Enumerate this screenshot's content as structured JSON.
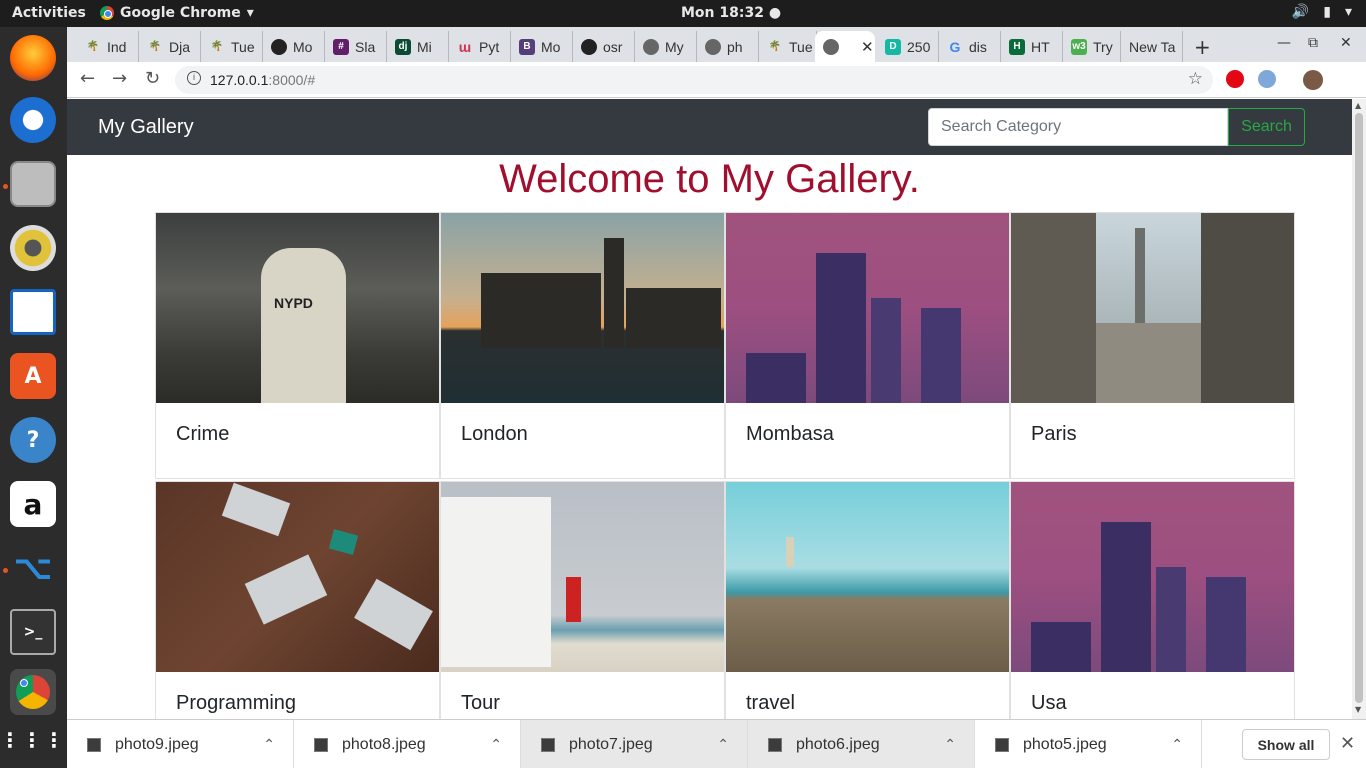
{
  "system": {
    "activities": "Activities",
    "app_name": "Google Chrome",
    "clock": "Mon 18:32"
  },
  "browser": {
    "tabs": [
      {
        "label": "Ind",
        "icon": "palm-icon"
      },
      {
        "label": "Dja",
        "icon": "palm-icon"
      },
      {
        "label": "Tue",
        "icon": "palm-icon"
      },
      {
        "label": "Mo",
        "icon": "github-icon"
      },
      {
        "label": "Sla",
        "icon": "slack-icon"
      },
      {
        "label": "Mi",
        "icon": "django-icon"
      },
      {
        "label": "Pyt",
        "icon": "python-icon"
      },
      {
        "label": "Mo",
        "icon": "bootstrap-icon"
      },
      {
        "label": "osr",
        "icon": "github-icon"
      },
      {
        "label": "My",
        "icon": "globe-icon"
      },
      {
        "label": "ph",
        "icon": "globe-icon"
      },
      {
        "label": "Tue",
        "icon": "palm-icon"
      },
      {
        "label": "",
        "icon": "globe-icon"
      },
      {
        "label": "250",
        "icon": "d-icon"
      },
      {
        "label": "dis",
        "icon": "google-icon"
      },
      {
        "label": "HT",
        "icon": "h-icon"
      },
      {
        "label": "Try",
        "icon": "w3-icon"
      },
      {
        "label": "New Ta",
        "icon": ""
      }
    ],
    "url_host": "127.0.0.1",
    "url_rest": ":8000/#"
  },
  "page": {
    "brand": "My Gallery",
    "search_placeholder": "Search Category",
    "search_button": "Search",
    "welcome": "Welcome to My Gallery.",
    "cards": [
      {
        "label": "Crime"
      },
      {
        "label": "London"
      },
      {
        "label": "Mombasa"
      },
      {
        "label": "Paris"
      },
      {
        "label": "Programming"
      },
      {
        "label": "Tour"
      },
      {
        "label": "travel"
      },
      {
        "label": "Usa"
      }
    ]
  },
  "downloads": {
    "items": [
      "photo9.jpeg",
      "photo8.jpeg",
      "photo7.jpeg",
      "photo6.jpeg",
      "photo5.jpeg"
    ],
    "show_all": "Show all"
  },
  "colors": {
    "navbar": "#343a40",
    "welcome": "#a0102e",
    "search_button": "#28a745"
  }
}
